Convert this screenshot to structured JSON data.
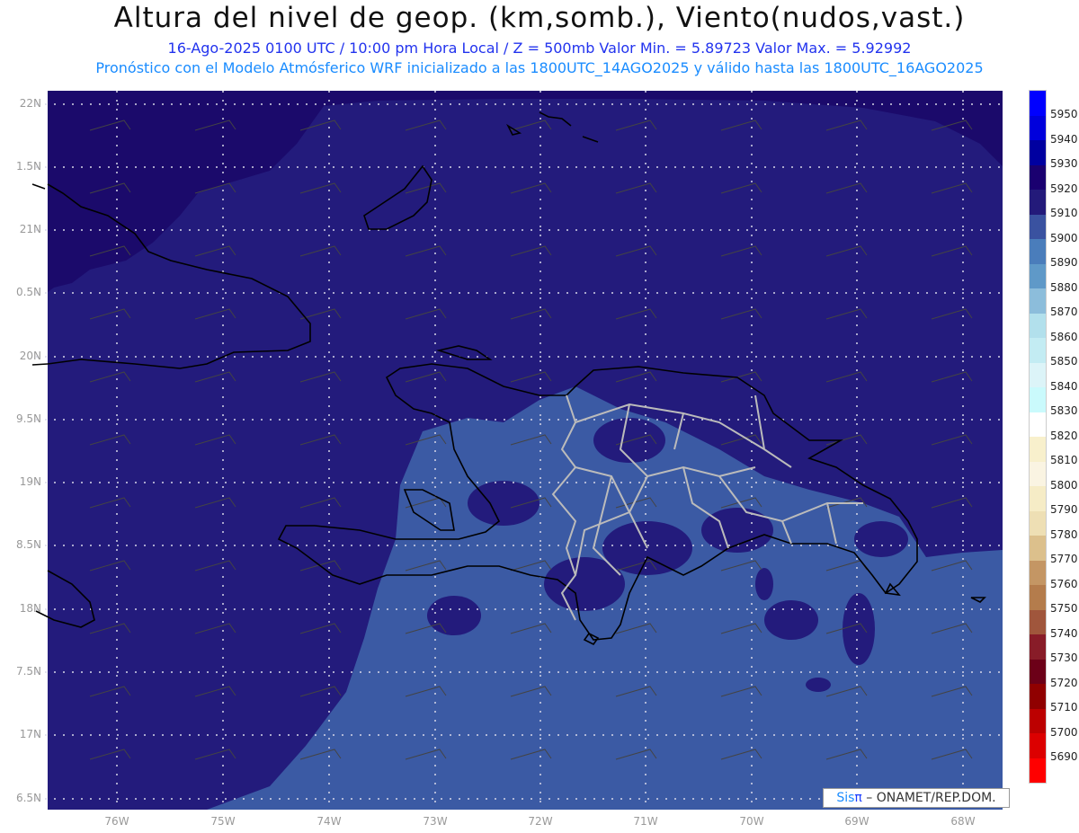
{
  "header": {
    "title": "Altura del nivel de geop. (km,somb.), Viento(nudos,vast.)",
    "subtitle1": "16-Ago-2025  0100 UTC / 10:00 pm Hora Local / Z = 500mb    Valor Min. = 5.89723   Valor Max. = 5.92992",
    "subtitle2": "Pronóstico con el Modelo Atmósferico WRF inicializado a las 1800UTC_14AGO2025 y válido hasta las  1800UTC_16AGO2025"
  },
  "axes": {
    "lat_labels": [
      "22N",
      "1.5N",
      "21N",
      "0.5N",
      "20N",
      "9.5N",
      "19N",
      "8.5N",
      "18N",
      "7.5N",
      "17N",
      "6.5N"
    ],
    "lon_labels": [
      "76W",
      "75W",
      "74W",
      "73W",
      "72W",
      "71W",
      "70W",
      "69W",
      "68W"
    ]
  },
  "colorbar": {
    "labels": [
      "5950",
      "5940",
      "5930",
      "5920",
      "5910",
      "5900",
      "5890",
      "5880",
      "5870",
      "5860",
      "5850",
      "5840",
      "5830",
      "5820",
      "5810",
      "5800",
      "5790",
      "5780",
      "5770",
      "5760",
      "5750",
      "5740",
      "5730",
      "5720",
      "5710",
      "5700",
      "5690"
    ],
    "colors": [
      "#0000ff",
      "#0000dc",
      "#0000a0",
      "#1a0070",
      "#231a7a",
      "#3a52a0",
      "#4a7dbb",
      "#5f99c8",
      "#8cbddb",
      "#b2e0ec",
      "#c3ecf3",
      "#dcf4f8",
      "#cafafc",
      "#ffffff",
      "#f8f0cc",
      "#faf4e2",
      "#f6ecc6",
      "#eedfb4",
      "#dcc08c",
      "#c49664",
      "#b47c4c",
      "#a0563c",
      "#881c28",
      "#6c0018",
      "#900000",
      "#bc0000",
      "#dc0000",
      "#ff0000"
    ]
  },
  "map_colors": {
    "above_5920": "#1b0a6b",
    "5910_5920": "#231b7c",
    "5900_5910": "#3b5aa4"
  },
  "logo": {
    "sis": "Sis",
    "pi": "π",
    "rest": " – ONAMET/REP.DOM."
  }
}
